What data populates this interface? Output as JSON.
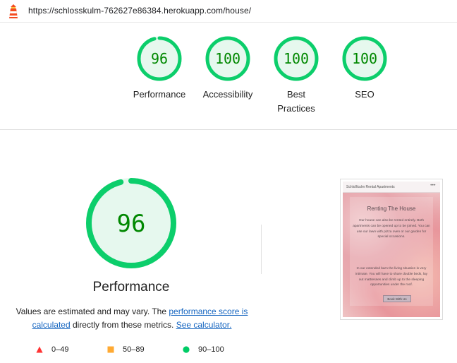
{
  "browser": {
    "url": "https://schlosskulm-762627e86384.herokuapp.com/house/"
  },
  "categories": [
    {
      "label": "Performance",
      "score": 96
    },
    {
      "label": "Accessibility",
      "score": 100
    },
    {
      "label": "Best Practices",
      "score": 100
    },
    {
      "label": "SEO",
      "score": 100
    }
  ],
  "main": {
    "score": 96,
    "title": "Performance",
    "desc_prefix": "Values are estimated and may vary. The ",
    "desc_link1": "performance score is calculated",
    "desc_middle": " directly from these metrics. ",
    "desc_link2": "See calculator."
  },
  "legend": [
    {
      "label": "0–49",
      "shape": "triangle",
      "color": "#ff3333"
    },
    {
      "label": "50–89",
      "shape": "square",
      "color": "#ffaa33"
    },
    {
      "label": "90–100",
      "shape": "circle",
      "color": "#00cc66"
    }
  ],
  "colors": {
    "pass": "#0cce6b",
    "pass_text": "#008800",
    "pass_fill": "#e6f8ee"
  },
  "thumbnail": {
    "site_name": "Schloßkulm Rental Apartments",
    "menu": "•••",
    "heading": "Renting The House",
    "para1": "Our house can also be rented entirely. Both apartments can be opened up to be joined. You can use our lawn with pizza oven or our garden for special occasions.",
    "para2": "In our extended barn the living situation is very intimate. You will have to share double beds, lay out mattresses and climb up to the sleeping opportunities under the roof.",
    "button": "Book With Us"
  }
}
